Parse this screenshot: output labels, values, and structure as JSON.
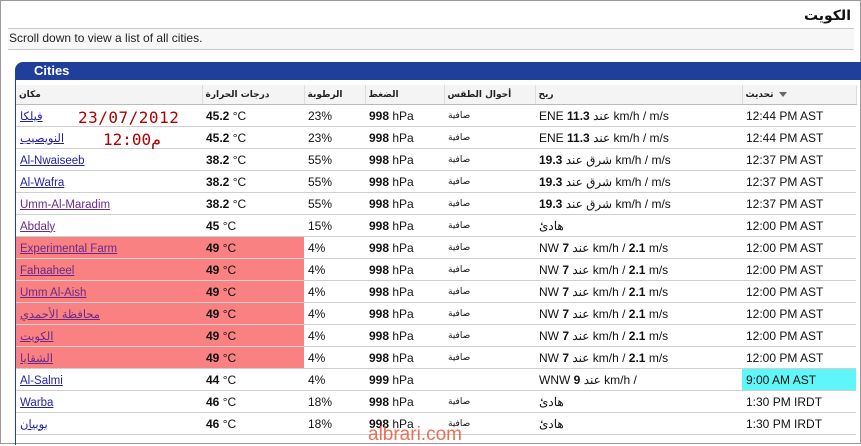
{
  "page": {
    "title": "الكويت",
    "subtitle": "Scroll down to view a list of all cities."
  },
  "panel": {
    "heading": "Cities"
  },
  "columns": {
    "location": "مكان",
    "temperature": "درجات الحرارة",
    "humidity": "الرطوبة",
    "pressure": "الضغط",
    "conditions": "أحوال الطقس",
    "wind": "ريح",
    "updated": "تحديث"
  },
  "rows": [
    {
      "name": "فيلكا",
      "temp": "45.2",
      "unit": " °C",
      "hum": "23%",
      "pres": "998",
      "punit": " hPa",
      "cond": "صافية",
      "wind_a": "ENE ",
      "wind_b": "11.3",
      "wind_c": " عند km/h /  m/s",
      "upd": "12:44 PM AST",
      "hot": false,
      "cyan": false,
      "visited": false
    },
    {
      "name": "النويصيب",
      "temp": "45.2",
      "unit": " °C",
      "hum": "23%",
      "pres": "998",
      "punit": " hPa",
      "cond": "صافية",
      "wind_a": "ENE ",
      "wind_b": "11.3",
      "wind_c": " عند km/h /  m/s",
      "upd": "12:44 PM AST",
      "hot": false,
      "cyan": false,
      "visited": false
    },
    {
      "name": "Al-Nwaiseeb",
      "temp": "38.2",
      "unit": " °C",
      "hum": "55%",
      "pres": "998",
      "punit": " hPa",
      "cond": "صافية",
      "wind_a": "",
      "wind_b": "19.3",
      "wind_c": " شرق عند km/h /  m/s",
      "upd": "12:37 PM AST",
      "hot": false,
      "cyan": false,
      "visited": false
    },
    {
      "name": "Al-Wafra",
      "temp": "38.2",
      "unit": " °C",
      "hum": "55%",
      "pres": "998",
      "punit": " hPa",
      "cond": "صافية",
      "wind_a": "",
      "wind_b": "19.3",
      "wind_c": " شرق عند km/h /  m/s",
      "upd": "12:37 PM AST",
      "hot": false,
      "cyan": false,
      "visited": false
    },
    {
      "name": "Umm-Al-Maradim",
      "temp": "38.2",
      "unit": " °C",
      "hum": "55%",
      "pres": "998",
      "punit": " hPa",
      "cond": "صافية",
      "wind_a": "",
      "wind_b": "19.3",
      "wind_c": " شرق عند km/h /  m/s",
      "upd": "12:37 PM AST",
      "hot": false,
      "cyan": false,
      "visited": true
    },
    {
      "name": "Abdaly",
      "temp": "45",
      "unit": " °C",
      "hum": "15%",
      "pres": "998",
      "punit": " hPa",
      "cond": "صافية",
      "wind_a": "",
      "wind_b": "",
      "wind_c": "هادئ",
      "upd": "12:00 PM AST",
      "hot": false,
      "cyan": false,
      "visited": true
    },
    {
      "name": "Experimental Farm",
      "temp": "49",
      "unit": " °C",
      "hum": "4%",
      "pres": "998",
      "punit": " hPa",
      "cond": "صافية",
      "wind_a": "NW ",
      "wind_b": "7",
      "wind_c": " عند km/h / ",
      "wind_d": "2.1",
      "wind_e": " m/s",
      "upd": "12:00 PM AST",
      "hot": true,
      "cyan": false,
      "visited": true
    },
    {
      "name": "Fahaaheel",
      "temp": "49",
      "unit": " °C",
      "hum": "4%",
      "pres": "998",
      "punit": " hPa",
      "cond": "صافية",
      "wind_a": "NW ",
      "wind_b": "7",
      "wind_c": " عند km/h / ",
      "wind_d": "2.1",
      "wind_e": " m/s",
      "upd": "12:00 PM AST",
      "hot": true,
      "cyan": false,
      "visited": true
    },
    {
      "name": "Umm Al-Aish",
      "temp": "49",
      "unit": " °C",
      "hum": "4%",
      "pres": "998",
      "punit": " hPa",
      "cond": "صافية",
      "wind_a": "NW ",
      "wind_b": "7",
      "wind_c": " عند km/h / ",
      "wind_d": "2.1",
      "wind_e": " m/s",
      "upd": "12:00 PM AST",
      "hot": true,
      "cyan": false,
      "visited": true
    },
    {
      "name": "محافظة الأحمدي",
      "temp": "49",
      "unit": " °C",
      "hum": "4%",
      "pres": "998",
      "punit": " hPa",
      "cond": "صافية",
      "wind_a": "NW ",
      "wind_b": "7",
      "wind_c": " عند km/h / ",
      "wind_d": "2.1",
      "wind_e": " m/s",
      "upd": "12:00 PM AST",
      "hot": true,
      "cyan": false,
      "visited": true
    },
    {
      "name": "الكويت",
      "temp": "49",
      "unit": " °C",
      "hum": "4%",
      "pres": "998",
      "punit": " hPa",
      "cond": "صافية",
      "wind_a": "NW ",
      "wind_b": "7",
      "wind_c": " عند km/h / ",
      "wind_d": "2.1",
      "wind_e": " m/s",
      "upd": "12:00 PM AST",
      "hot": true,
      "cyan": false,
      "visited": true
    },
    {
      "name": "الشقايا",
      "temp": "49",
      "unit": " °C",
      "hum": "4%",
      "pres": "998",
      "punit": " hPa",
      "cond": "صافية",
      "wind_a": "NW ",
      "wind_b": "7",
      "wind_c": " عند km/h / ",
      "wind_d": "2.1",
      "wind_e": " m/s",
      "upd": "12:00 PM AST",
      "hot": true,
      "cyan": false,
      "visited": true
    },
    {
      "name": "Al-Salmi",
      "temp": "44",
      "unit": " °C",
      "hum": "4%",
      "pres": "999",
      "punit": " hPa",
      "cond": "",
      "wind_a": "WNW ",
      "wind_b": "9",
      "wind_c": " عند km/h /",
      "upd": "9:00 AM AST",
      "hot": false,
      "cyan": true,
      "visited": false
    },
    {
      "name": "Warba",
      "temp": "46",
      "unit": " °C",
      "hum": "18%",
      "pres": "998",
      "punit": " hPa",
      "cond": "صافية",
      "wind_a": "",
      "wind_b": "",
      "wind_c": "هادئ",
      "upd": "1:30 PM IRDT",
      "hot": false,
      "cyan": false,
      "visited": false
    },
    {
      "name": "بوبيان",
      "temp": "46",
      "unit": " °C",
      "hum": "18%",
      "pres": "998",
      "punit": " hPa",
      "cond": "صافية",
      "wind_a": "",
      "wind_b": "",
      "wind_c": "هادئ",
      "upd": "1:30 PM IRDT",
      "hot": false,
      "cyan": false,
      "visited": false
    }
  ],
  "annotation": {
    "date": "23/07/2012",
    "time": "12:00م"
  },
  "watermark": "albrari.com",
  "colors": {
    "header": "#1f3f9a",
    "highlight": "#f98181",
    "latest": "#5ff6f9",
    "stamp": "#b00000"
  }
}
